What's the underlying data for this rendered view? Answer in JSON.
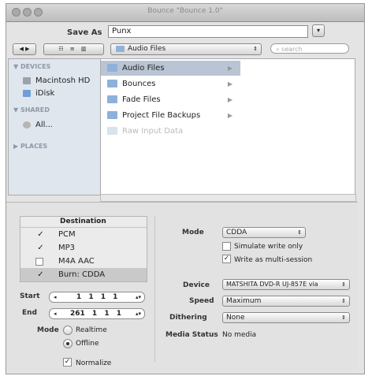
{
  "window": {
    "title": "Bounce \"Bounce 1.0\""
  },
  "save_as": {
    "label": "Save As",
    "value": "Punx"
  },
  "toolbar": {
    "nav_back": "◀",
    "nav_fwd": "▶",
    "view_icons": "☷ ≡ ▥",
    "folder_name": "Audio Files",
    "search_placeholder": "search"
  },
  "sidebar": {
    "devices_head": "DEVICES",
    "devices": [
      {
        "label": "Macintosh HD"
      },
      {
        "label": "iDisk"
      }
    ],
    "shared_head": "SHARED",
    "shared": [
      {
        "label": "All..."
      }
    ],
    "places_head": "PLACES"
  },
  "browser": {
    "column1": [
      {
        "label": "Audio Files",
        "selected": true,
        "disabled": false
      },
      {
        "label": "Bounces",
        "selected": false,
        "disabled": false
      },
      {
        "label": "Fade Files",
        "selected": false,
        "disabled": false
      },
      {
        "label": "Project File Backups",
        "selected": false,
        "disabled": false
      },
      {
        "label": "Raw Input Data",
        "selected": false,
        "disabled": true
      }
    ]
  },
  "destination": {
    "header": "Destination",
    "rows": [
      {
        "label": "PCM",
        "checked": true,
        "selected": false
      },
      {
        "label": "MP3",
        "checked": true,
        "selected": false
      },
      {
        "label": "M4A AAC",
        "checked": false,
        "selected": false
      },
      {
        "label": "Burn: CDDA",
        "checked": true,
        "selected": true
      }
    ]
  },
  "range": {
    "start_label": "Start",
    "start_value": "1 1 1 1",
    "end_label": "End",
    "end_value": "261 1 1 1"
  },
  "mode_left": {
    "label": "Mode",
    "options": [
      {
        "label": "Realtime",
        "selected": false
      },
      {
        "label": "Offline",
        "selected": true
      }
    ]
  },
  "normalize": {
    "label": "Normalize",
    "checked": true
  },
  "burn": {
    "mode_label": "Mode",
    "mode_value": "CDDA",
    "simulate_label": "Simulate write only",
    "simulate_checked": false,
    "multisession_label": "Write as multi-session",
    "multisession_checked": true,
    "device_label": "Device",
    "device_value": "MATSHITA DVD-R UJ-857E via",
    "speed_label": "Speed",
    "speed_value": "Maximum",
    "dithering_label": "Dithering",
    "dithering_value": "None",
    "media_status_label": "Media Status",
    "media_status_value": "No media"
  }
}
